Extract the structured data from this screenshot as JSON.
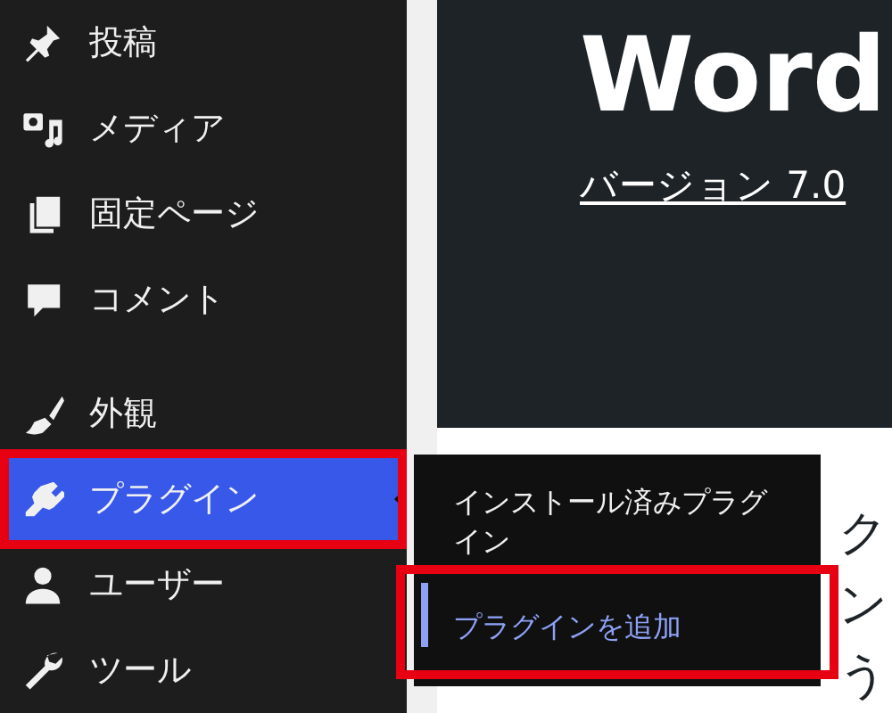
{
  "sidebar": {
    "groups": [
      [
        {
          "label": "投稿",
          "selected": false,
          "highlighted": false
        },
        {
          "label": "メディア",
          "selected": false,
          "highlighted": false
        },
        {
          "label": "固定ページ",
          "selected": false,
          "highlighted": false
        },
        {
          "label": "コメント",
          "selected": false,
          "highlighted": false
        }
      ],
      [
        {
          "label": "外観",
          "selected": false,
          "highlighted": false
        },
        {
          "label": "プラグイン",
          "selected": true,
          "highlighted": true
        },
        {
          "label": "ユーザー",
          "selected": false,
          "highlighted": false
        },
        {
          "label": "ツール",
          "selected": false,
          "highlighted": false
        }
      ]
    ]
  },
  "flyout": {
    "items": [
      {
        "label": "インストール済みプラグイン",
        "selected": false,
        "highlighted": false
      },
      {
        "label": "プラグインを追加",
        "selected": true,
        "highlighted": true
      }
    ]
  },
  "hero": {
    "title": "Word",
    "version_link": "バージョン 7.0"
  },
  "content": {
    "lines": [
      "ク",
      "ン",
      "う"
    ]
  }
}
